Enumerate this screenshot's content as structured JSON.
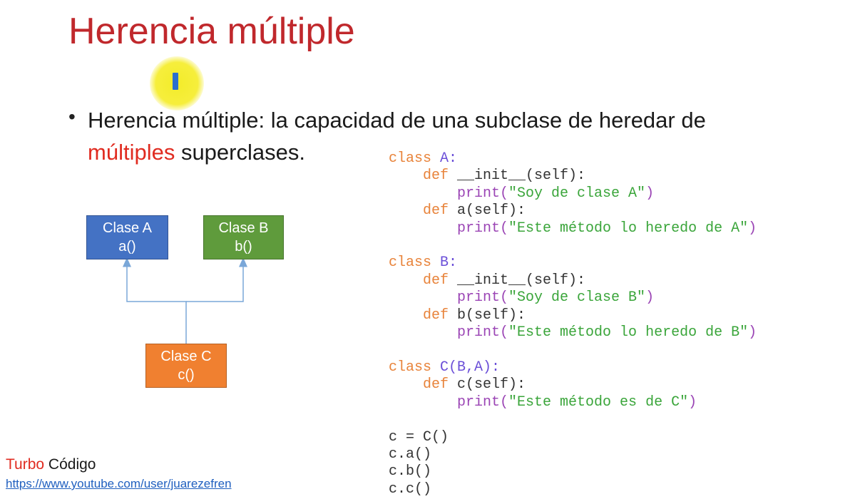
{
  "slide": {
    "title": "Herencia múltiple",
    "bullet": {
      "prefix": "Herencia múltiple: la capacidad de una subclase de heredar de",
      "highlight": "múltiples",
      "suffix": " superclases."
    }
  },
  "diagram": {
    "class_a": {
      "name": "Clase A",
      "method": "a()"
    },
    "class_b": {
      "name": "Clase B",
      "method": "b()"
    },
    "class_c": {
      "name": "Clase C",
      "method": "c()"
    }
  },
  "code": {
    "kw_class": "class",
    "kw_def": "def",
    "lines": {
      "l1_name": " A:",
      "l2_rest": " __init__(self):",
      "l3_fn": "print(",
      "l3_str": "\"Soy de clase A\"",
      "l3_end": ")",
      "l4_rest": " a(self):",
      "l5_fn": "print(",
      "l5_str": "\"Este método lo heredo de A\"",
      "l5_end": ")",
      "l6_name": " B:",
      "l7_rest": " __init__(self):",
      "l8_fn": "print(",
      "l8_str": "\"Soy de clase B\"",
      "l8_end": ")",
      "l9_rest": " b(self):",
      "l10_fn": "print(",
      "l10_str": "\"Este método lo heredo de B\"",
      "l10_end": ")",
      "l11_name": " C(B,A):",
      "l12_rest": " c(self):",
      "l13_fn": "print(",
      "l13_str": "\"Este método es de C\"",
      "l13_end": ")",
      "l14": "c = C()",
      "l15": "c.a()",
      "l16": "c.b()",
      "l17": "c.c()"
    }
  },
  "footer": {
    "brand_turbo": "Turbo",
    "brand_rest": " Código",
    "url": "https://www.youtube.com/user/juarezefren"
  },
  "colors": {
    "title": "#c0282c",
    "highlight": "#e02b20",
    "class_a": "#4472c4",
    "class_b": "#5f9b3c",
    "class_c": "#f08030",
    "connector": "#7aa7d8"
  }
}
